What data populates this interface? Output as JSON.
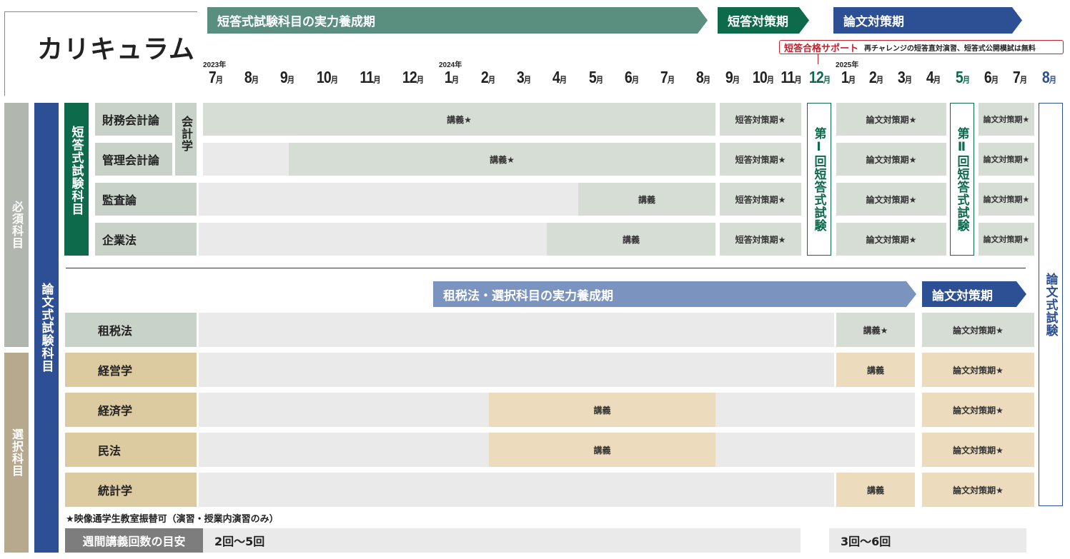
{
  "title": "カリキュラム",
  "phases": {
    "short_build": "短答式試験科目の実力養成期",
    "short_prep": "短答対策期",
    "essay_prep": "論文対策期",
    "tax_build": "租税法・選択科目の実力養成期",
    "tax_essay_prep": "論文対策期"
  },
  "support": {
    "label": "短答合格サポート",
    "note": "再チャレンジの短答直対演習、短答式公開模試は無料"
  },
  "years": [
    "2023年",
    "2024年",
    "2025年"
  ],
  "months": [
    "7",
    "8",
    "9",
    "10",
    "11",
    "12",
    "1",
    "2",
    "3",
    "4",
    "5",
    "6",
    "7",
    "8",
    "9",
    "10",
    "11",
    "12",
    "1",
    "2",
    "3",
    "4",
    "5",
    "6",
    "7",
    "8"
  ],
  "month_suffix": "月",
  "colors": {
    "short_green": "#0d6a4a",
    "phase_teal": "#5a8f80",
    "essay_blue": "#2d4f93",
    "tax_blue": "#7b93bf",
    "required_gray": "#b1b6ae",
    "elective_tan": "#b6a98d",
    "subject_green": "#c9d2c8",
    "subject_tan": "#dccaa0"
  },
  "categories": {
    "required": "必須科目",
    "elective": "選択科目",
    "essay_subjects": "論文式試験科目",
    "short_subjects": "短答式試験科目",
    "accounting": "会計学"
  },
  "subjects": {
    "financial": "財務会計論",
    "managerial": "管理会計論",
    "audit": "監査論",
    "corporate": "企業法",
    "tax": "租税法",
    "management": "経営学",
    "economics": "経済学",
    "civil": "民法",
    "statistics": "統計学"
  },
  "cells": {
    "lecture_star": "講義★",
    "lecture": "講義",
    "short_prep_star": "短答対策期★",
    "essay_prep_star": "論文対策期★"
  },
  "exams": {
    "first": "第Ⅰ回短答式試験",
    "second": "第Ⅱ回短答式試験",
    "essay": "論文式試験"
  },
  "footnote": "★映像通学生教室振替可（演習・授業内演習のみ）",
  "weekly": {
    "label": "週間講義回数の目安",
    "first_range": "2回～5回",
    "second_range": "3回～6回"
  }
}
